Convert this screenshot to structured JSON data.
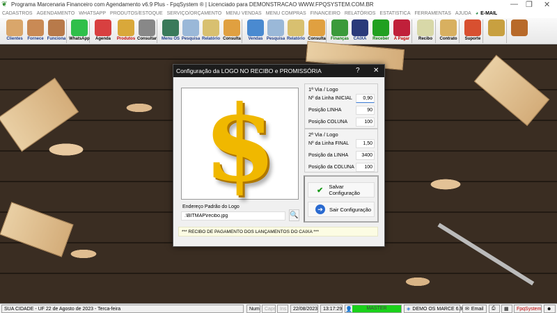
{
  "window": {
    "title": "Programa Marcenaria Financeiro com Agendamento v6.9 Plus - FpqSystem ® | Licenciado para  DEMONSTRACAO WWW.FPQSYSTEM.COM.BR",
    "minimize": "—",
    "maximize": "❐",
    "close": "✕"
  },
  "menu": [
    "CADASTROS",
    "AGENDAMENTO",
    "WHATSAPP",
    "PRODUTOS/ESTOQUE",
    "SERVIÇO/ORÇAMENTO",
    "MENU VENDAS",
    "MENU COMPRAS",
    "FINANCEIRO",
    "RELATÓRIOS",
    "ESTATISTICA",
    "FERRAMENTAS",
    "AJUDA"
  ],
  "menu_email": "E-MAIL",
  "toolbar": [
    {
      "label": "Clientes",
      "icon": "clients-icon",
      "color": "#1a3a8a",
      "bg": "#d9a66b"
    },
    {
      "label": "Fornece",
      "icon": "supplier-icon",
      "color": "#1a3a8a",
      "bg": "#c98a55"
    },
    {
      "label": "Funciona",
      "icon": "employee-icon",
      "color": "#1a3a8a",
      "bg": "#b87a4a"
    },
    {
      "label": "WhatsApp",
      "icon": "whatsapp-icon",
      "color": "#000",
      "bg": "#2fbf4a"
    },
    {
      "label": "Agenda",
      "icon": "calendar-icon",
      "color": "#000",
      "bg": "#d84040"
    },
    {
      "label": "Produtos",
      "icon": "boxes-icon",
      "color": "#c00000",
      "bg": "#d9a83a"
    },
    {
      "label": "Consultar",
      "icon": "barcode-icon",
      "color": "#000",
      "bg": "#888888"
    },
    {
      "label": "Menu OS",
      "icon": "clipboard-icon",
      "color": "#1a3a8a",
      "bg": "#3a7a5a"
    },
    {
      "label": "Pesquisa",
      "icon": "search-doc-icon",
      "color": "#1a3a8a",
      "bg": "#9ab8d8"
    },
    {
      "label": "Relatório",
      "icon": "printer-icon",
      "color": "#1a3a8a",
      "bg": "#d8c070"
    },
    {
      "label": "Consulta",
      "icon": "folder-box-icon",
      "color": "#000",
      "bg": "#e0a040"
    },
    {
      "label": "Vendas",
      "icon": "monitor-icon",
      "color": "#1a3a8a",
      "bg": "#4a8ad0"
    },
    {
      "label": "Pesquisa",
      "icon": "search-doc-icon",
      "color": "#1a3a8a",
      "bg": "#9ab8d8"
    },
    {
      "label": "Relatório",
      "icon": "printer-icon",
      "color": "#1a3a8a",
      "bg": "#d8c070"
    },
    {
      "label": "Consulta",
      "icon": "folder-box-icon",
      "color": "#000",
      "bg": "#e0a040"
    },
    {
      "label": "Finanças",
      "icon": "finance-chart-icon",
      "color": "#0a7a0a",
      "bg": "#3a9a3a"
    },
    {
      "label": "CAIXA",
      "icon": "cash-book-icon",
      "color": "#1a3a8a",
      "bg": "#2a3a7a"
    },
    {
      "label": "Receber",
      "icon": "dollar-green-icon",
      "color": "#0a7a0a",
      "bg": "#20a020"
    },
    {
      "label": "A Pagar",
      "icon": "dollar-red-icon",
      "color": "#c00000",
      "bg": "#c0203a"
    },
    {
      "label": "Recibo",
      "icon": "receipt-icon",
      "color": "#000",
      "bg": "#d8d8a8"
    },
    {
      "label": "Contrato",
      "icon": "contract-icon",
      "color": "#000",
      "bg": "#d8b060"
    },
    {
      "label": "Suporte",
      "icon": "support-icon",
      "color": "#000",
      "bg": "#d85030"
    },
    {
      "label": "",
      "icon": "coins-icon",
      "color": "#000",
      "bg": "#c8a040"
    },
    {
      "label": "",
      "icon": "exit-door-icon",
      "color": "#000",
      "bg": "#b86a2a"
    }
  ],
  "dialog": {
    "title": "Configuração da LOGO NO RECIBO e PROMISSÓRIA",
    "help": "?",
    "close": "✕",
    "logo_glyph": "$",
    "via1": {
      "title": "1ª Via / Logo",
      "rows": [
        {
          "label": "Nº da Linha INICIAL",
          "value": "0,90"
        },
        {
          "label": "Posição LINHA",
          "value": "90"
        },
        {
          "label": "Posição COLUNA",
          "value": "100"
        }
      ]
    },
    "via2": {
      "title": "2ª Via / Logo",
      "rows": [
        {
          "label": "Nº da Linha FINAL",
          "value": "1,50"
        },
        {
          "label": "Posição da LINHA",
          "value": "3400"
        },
        {
          "label": "Posição da COLUNA",
          "value": "100"
        }
      ]
    },
    "save_label": "Salvar Configuração",
    "exit_label": "Sair Configuração",
    "address_label": "Endereço Padrão do Logo",
    "address_value": ".\\BITMAP\\recibo.jpg",
    "message": "*** RECIBO DE PAGAMENTO DOS LANÇAMENTOS DO CAIXA ***"
  },
  "status": {
    "city": "SUA CIDADE - UF 22 de Agosto de 2023 - Terca-feira",
    "num": "Num",
    "caps": "Caps",
    "ins": "Ins",
    "date": "22/08/2023",
    "time": "13:17:29",
    "user": "MASTER",
    "company": "DEMO OS MARCE 6.9",
    "email": "Email",
    "brand": "FpqSystem"
  },
  "colors": {
    "master_bg": "#1ad21a",
    "brand": "#c00000"
  }
}
